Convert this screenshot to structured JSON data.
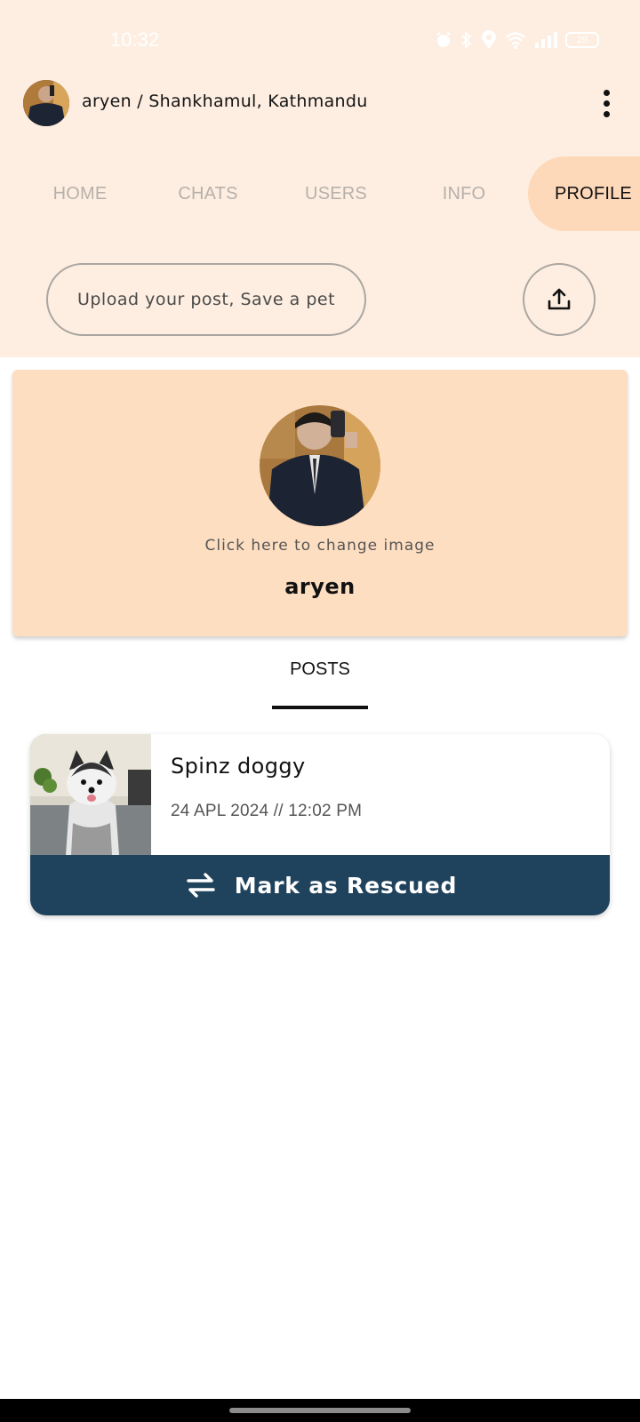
{
  "status_bar": {
    "time": "10:32",
    "battery": "29"
  },
  "header": {
    "title": "aryen / Shankhamul, Kathmandu"
  },
  "tabs": [
    {
      "label": "HOME"
    },
    {
      "label": "CHATS"
    },
    {
      "label": "USERS"
    },
    {
      "label": "INFO"
    },
    {
      "label": "PROFILE"
    }
  ],
  "upload": {
    "placeholder": "Upload your post, Save a pet"
  },
  "profile": {
    "change_image_label": "Click here to change image",
    "name": "aryen"
  },
  "posts_tab": {
    "label": "POSTS"
  },
  "posts": [
    {
      "title": "Spinz doggy",
      "date": "24 APL 2024 // 12:02 PM",
      "action_label": "Mark as Rescued"
    }
  ],
  "colors": {
    "accent_navy": "#20435d",
    "card_peach": "#fedec1",
    "header_bg": "#fdeee1"
  }
}
